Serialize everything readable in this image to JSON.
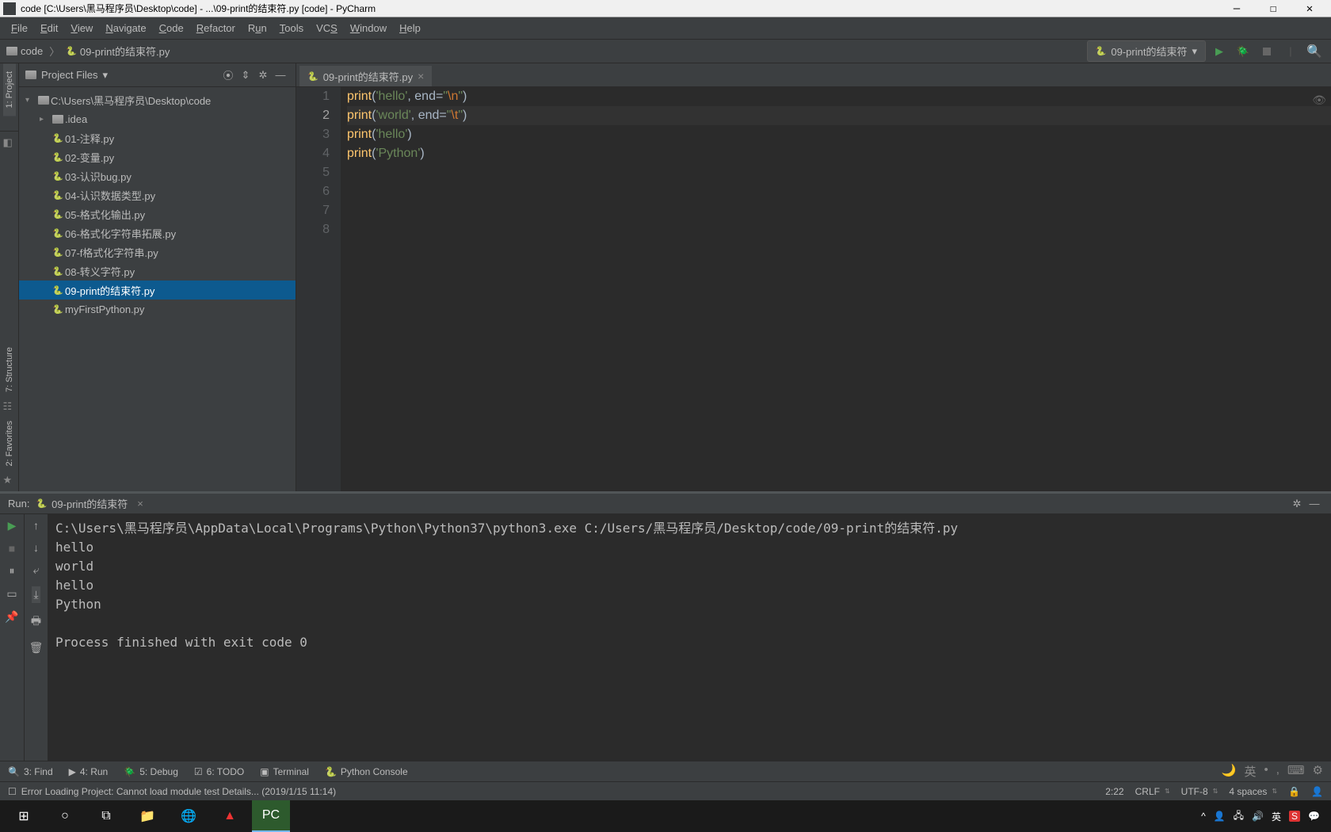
{
  "window": {
    "title": "code [C:\\Users\\黑马程序员\\Desktop\\code] - ...\\09-print的结束符.py [code] - PyCharm"
  },
  "menu": [
    "File",
    "Edit",
    "View",
    "Navigate",
    "Code",
    "Refactor",
    "Run",
    "Tools",
    "VCS",
    "Window",
    "Help"
  ],
  "breadcrumb": {
    "root": "code",
    "file": "09-print的结束符.py"
  },
  "runConfig": {
    "name": "09-print的结束符"
  },
  "leftTabs": {
    "project": "1: Project",
    "structure": "7: Structure",
    "favorites": "2: Favorites"
  },
  "projectPanel": {
    "title": "Project Files",
    "root": "C:\\Users\\黑马程序员\\Desktop\\code",
    "idea": ".idea",
    "files": [
      "01-注释.py",
      "02-变量.py",
      "03-认识bug.py",
      "04-认识数据类型.py",
      "05-格式化输出.py",
      "06-格式化字符串拓展.py",
      "07-f格式化字符串.py",
      "08-转义字符.py",
      "09-print的结束符.py",
      "myFirstPython.py"
    ],
    "selectedIndex": 8
  },
  "editor": {
    "tab": "09-print的结束符.py",
    "lines": [
      {
        "tokens": [
          {
            "t": "fn",
            "v": "print"
          },
          {
            "t": "plain",
            "v": "("
          },
          {
            "t": "str",
            "v": "'hello'"
          },
          {
            "t": "plain",
            "v": ", "
          },
          {
            "t": "plain",
            "v": "end"
          },
          {
            "t": "plain",
            "v": "="
          },
          {
            "t": "str",
            "v": "\""
          },
          {
            "t": "esc",
            "v": "\\n"
          },
          {
            "t": "str",
            "v": "\""
          },
          {
            "t": "plain",
            "v": ")"
          }
        ]
      },
      {
        "tokens": [
          {
            "t": "fn",
            "v": "print"
          },
          {
            "t": "plain",
            "v": "("
          },
          {
            "t": "str",
            "v": "'world'"
          },
          {
            "t": "plain",
            "v": ", "
          },
          {
            "t": "plain",
            "v": "end"
          },
          {
            "t": "plain",
            "v": "="
          },
          {
            "t": "str",
            "v": "\""
          },
          {
            "t": "esc",
            "v": "\\t"
          },
          {
            "t": "str",
            "v": "\""
          },
          {
            "t": "plain",
            "v": ")"
          }
        ]
      },
      {
        "tokens": [
          {
            "t": "fn",
            "v": "print"
          },
          {
            "t": "plain",
            "v": "("
          },
          {
            "t": "str",
            "v": "'hello'"
          },
          {
            "t": "plain",
            "v": ")"
          }
        ]
      },
      {
        "tokens": [
          {
            "t": "fn",
            "v": "print"
          },
          {
            "t": "plain",
            "v": "("
          },
          {
            "t": "str",
            "v": "'Python'"
          },
          {
            "t": "plain",
            "v": ")"
          }
        ]
      },
      {
        "tokens": []
      },
      {
        "tokens": []
      },
      {
        "tokens": []
      },
      {
        "tokens": []
      }
    ],
    "currentLine": 2
  },
  "run": {
    "label": "Run:",
    "tab": "09-print的结束符",
    "output": "C:\\Users\\黑马程序员\\AppData\\Local\\Programs\\Python\\Python37\\python3.exe C:/Users/黑马程序员/Desktop/code/09-print的结束符.py\nhello\nworld\nhello\nPython\n\nProcess finished with exit code 0"
  },
  "bottomTabs": {
    "find": "3: Find",
    "run": "4: Run",
    "debug": "5: Debug",
    "todo": "6: TODO",
    "terminal": "Terminal",
    "pyconsole": "Python Console"
  },
  "status": {
    "message": "Error Loading Project: Cannot load module test Details... (2019/1/15 11:14)",
    "pos": "2:22",
    "lineEnd": "CRLF",
    "encoding": "UTF-8",
    "indent": "4 spaces"
  }
}
